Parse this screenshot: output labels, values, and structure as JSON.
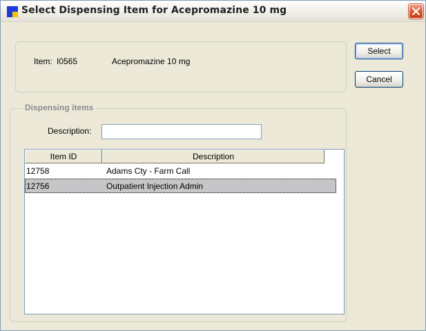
{
  "window": {
    "title": "Select Dispensing Item for Acepromazine 10 mg"
  },
  "item_info": {
    "item_label": "Item:",
    "item_code": "I0565",
    "item_name": "Acepromazine 10 mg"
  },
  "buttons": {
    "select_label": "Select",
    "cancel_label": "Cancel"
  },
  "dispensing_items": {
    "group_title": "Dispensing items",
    "description_label": "Description:",
    "description_value": "",
    "columns": [
      "Item ID",
      "Description"
    ],
    "rows": [
      {
        "item_id": "12758",
        "description": "Adams Cty - Farm Call",
        "selected": false
      },
      {
        "item_id": "12756",
        "description": "Outpatient Injection Admin",
        "selected": true
      }
    ]
  },
  "icons": {
    "app": "app-window-icon",
    "close": "close-icon"
  },
  "colors": {
    "dialog_bg": "#ece9d8",
    "close_button": "#d9532e",
    "selected_row": "#c6c6c8"
  }
}
